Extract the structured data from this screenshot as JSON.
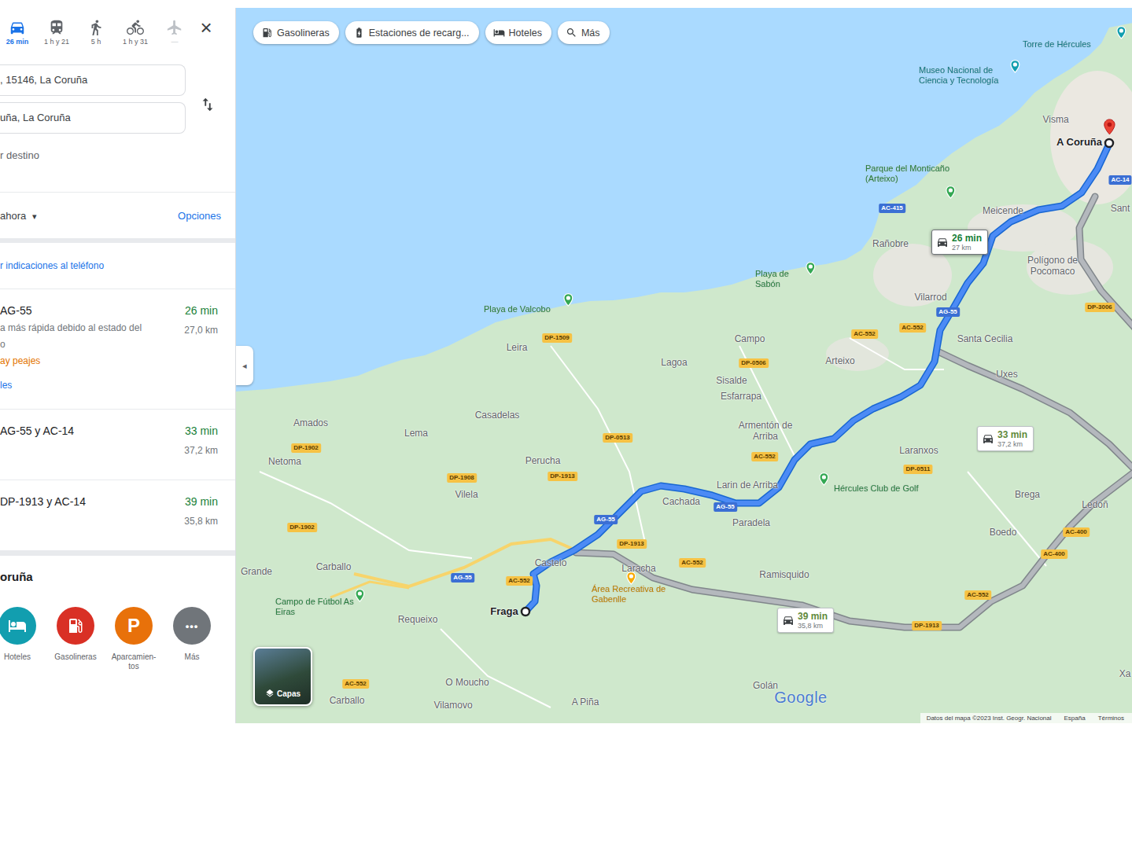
{
  "panel": {
    "travel_modes": [
      {
        "kind": "car",
        "label": "26 min",
        "selected": true,
        "disabled": false
      },
      {
        "kind": "transit",
        "label": "1 h y 21",
        "selected": false,
        "disabled": false
      },
      {
        "kind": "walk",
        "label": "5 h",
        "selected": false,
        "disabled": false
      },
      {
        "kind": "bike",
        "label": "1 h y 31",
        "selected": false,
        "disabled": false
      },
      {
        "kind": "flight",
        "label": "—",
        "selected": false,
        "disabled": true
      }
    ],
    "close": "×",
    "origin": ", 15146, La Coruña",
    "destination": "uña, La Coruña",
    "add_destination": "r destino",
    "departure": "ahora",
    "departure_caret": "▾",
    "options": "Opciones",
    "send_to_phone": "r indicaciones al teléfono",
    "routes": [
      {
        "name": "AG-55",
        "time": "26 min",
        "distance": "27,0 km",
        "notes": [
          "a más rápida debido al estado del",
          "o"
        ],
        "warning": "ay peajes",
        "link": "les"
      },
      {
        "name": "AG-55 y AC-14",
        "time": "33 min",
        "distance": "37,2 km",
        "notes": []
      },
      {
        "name": "DP-1913 y AC-14",
        "time": "39 min",
        "distance": "35,8 km",
        "notes": []
      }
    ],
    "nearby": {
      "title": "oruña",
      "items": [
        {
          "kind": "hotel",
          "label": "Hoteles",
          "color": "#129eaf"
        },
        {
          "kind": "gas",
          "label": "Gasolineras",
          "color": "#d93025"
        },
        {
          "kind": "parking",
          "label": "Aparcamien-tos",
          "glyph": "P",
          "color": "#e8710a"
        },
        {
          "kind": "more",
          "label": "Más",
          "glyph": "•••",
          "color": "#70757a"
        }
      ]
    },
    "collapse": "◂"
  },
  "map": {
    "chips": [
      {
        "kind": "gas",
        "label": "Gasolineras"
      },
      {
        "kind": "charging",
        "label": "Estaciones de recarg..."
      },
      {
        "kind": "hotel",
        "label": "Hoteles"
      },
      {
        "kind": "search",
        "label": "Más"
      }
    ],
    "places": [
      {
        "label": "Visma",
        "kind": "town"
      },
      {
        "label": "A Coruña",
        "kind": "city"
      },
      {
        "label": "Meicende",
        "kind": "town"
      },
      {
        "label": "Rañobre",
        "kind": "town"
      },
      {
        "label": "Polígono de Pocomaco",
        "kind": "town"
      },
      {
        "label": "Vilarrod",
        "kind": "town"
      },
      {
        "label": "Santa Cecilia",
        "kind": "town"
      },
      {
        "label": "Campo",
        "kind": "town"
      },
      {
        "label": "Lagoa",
        "kind": "town"
      },
      {
        "label": "Sisalde",
        "kind": "town"
      },
      {
        "label": "Esfarrapa",
        "kind": "town"
      },
      {
        "label": "Arteixo",
        "kind": "town"
      },
      {
        "label": "Uxes",
        "kind": "town"
      },
      {
        "label": "Leira",
        "kind": "town"
      },
      {
        "label": "Casadelas",
        "kind": "town"
      },
      {
        "label": "Armentón de Arriba",
        "kind": "town"
      },
      {
        "label": "Laranxos",
        "kind": "town"
      },
      {
        "label": "Amados",
        "kind": "town"
      },
      {
        "label": "Lema",
        "kind": "town"
      },
      {
        "label": "Netoma",
        "kind": "town"
      },
      {
        "label": "Perucha",
        "kind": "town"
      },
      {
        "label": "Vilela",
        "kind": "town"
      },
      {
        "label": "Larin de Arriba",
        "kind": "town"
      },
      {
        "label": "Cachada",
        "kind": "town"
      },
      {
        "label": "Paradela",
        "kind": "town"
      },
      {
        "label": "Brega",
        "kind": "town"
      },
      {
        "label": "Ledoñ",
        "kind": "town"
      },
      {
        "label": "Boedo",
        "kind": "town"
      },
      {
        "label": "Carballo",
        "kind": "town"
      },
      {
        "label": "Castelo",
        "kind": "town"
      },
      {
        "label": "Fraga",
        "kind": "city"
      },
      {
        "label": "Laracha",
        "kind": "town"
      },
      {
        "label": "Ramisquido",
        "kind": "town"
      },
      {
        "label": "Requeixo",
        "kind": "town"
      },
      {
        "label": "Grande",
        "kind": "town"
      },
      {
        "label": "O Moucho",
        "kind": "town"
      },
      {
        "label": "Vilamovo",
        "kind": "town"
      },
      {
        "label": "A Piña",
        "kind": "town"
      },
      {
        "label": "Golán",
        "kind": "town"
      },
      {
        "label": "Carballo",
        "kind": "town"
      },
      {
        "label": "Sant",
        "kind": "town"
      },
      {
        "label": "Xa",
        "kind": "town"
      }
    ],
    "pois": [
      {
        "label": "Torre de Hércules",
        "color": "#129eaf"
      },
      {
        "label": "Museo Nacional de Ciencia y Tecnología",
        "color": "#129eaf"
      },
      {
        "label": "Parque del Monticaño (Arteixo)",
        "color": "#34a853"
      },
      {
        "label": "Playa de Sabón",
        "color": "#34a853"
      },
      {
        "label": "Playa de Valcobo",
        "color": "#34a853"
      },
      {
        "label": "Hércules Club de Golf",
        "color": "#34a853"
      },
      {
        "label": "Área Recreativa de Gabenlle",
        "color": "#f9ab00"
      },
      {
        "label": "Campo de Fútbol As Eiras",
        "color": "#34a853"
      }
    ],
    "roads": [
      {
        "label": "AC-415",
        "kind": "highway"
      },
      {
        "label": "AG-55",
        "kind": "highway"
      },
      {
        "label": "AG-55",
        "kind": "highway"
      },
      {
        "label": "AG-55",
        "kind": "highway"
      },
      {
        "label": "AG-55",
        "kind": "highway"
      },
      {
        "label": "AC-552",
        "kind": "regional"
      },
      {
        "label": "AC-552",
        "kind": "regional"
      },
      {
        "label": "DP-1509",
        "kind": "regional"
      },
      {
        "label": "DP-0506",
        "kind": "regional"
      },
      {
        "label": "DP-0513",
        "kind": "regional"
      },
      {
        "label": "DP-1908",
        "kind": "regional"
      },
      {
        "label": "DP-1913",
        "kind": "regional"
      },
      {
        "label": "DP-1902",
        "kind": "regional"
      },
      {
        "label": "DP-1902",
        "kind": "regional"
      },
      {
        "label": "AC-552",
        "kind": "regional"
      },
      {
        "label": "DP-1913",
        "kind": "regional"
      },
      {
        "label": "AC-552",
        "kind": "regional"
      },
      {
        "label": "AC-552",
        "kind": "regional"
      },
      {
        "label": "DP-0511",
        "kind": "regional"
      },
      {
        "label": "DP-1913",
        "kind": "regional"
      },
      {
        "label": "AC-552",
        "kind": "regional"
      },
      {
        "label": "AC-400",
        "kind": "regional"
      },
      {
        "label": "AC-400",
        "kind": "regional"
      },
      {
        "label": "DP-3006",
        "kind": "regional"
      },
      {
        "label": "AC-552",
        "kind": "regional"
      },
      {
        "label": "AC-14",
        "kind": "highway"
      }
    ],
    "route_boxes": [
      {
        "time": "26 min",
        "distance": "27 km",
        "selected": true
      },
      {
        "time": "33 min",
        "distance": "37,2 km",
        "selected": false
      },
      {
        "time": "39 min",
        "distance": "35,8 km",
        "selected": false
      }
    ],
    "layers": "Capas",
    "logo": "Google",
    "footer": [
      "Datos del mapa ©2023 Inst. Geogr. Nacional",
      "España",
      "Términos"
    ]
  }
}
